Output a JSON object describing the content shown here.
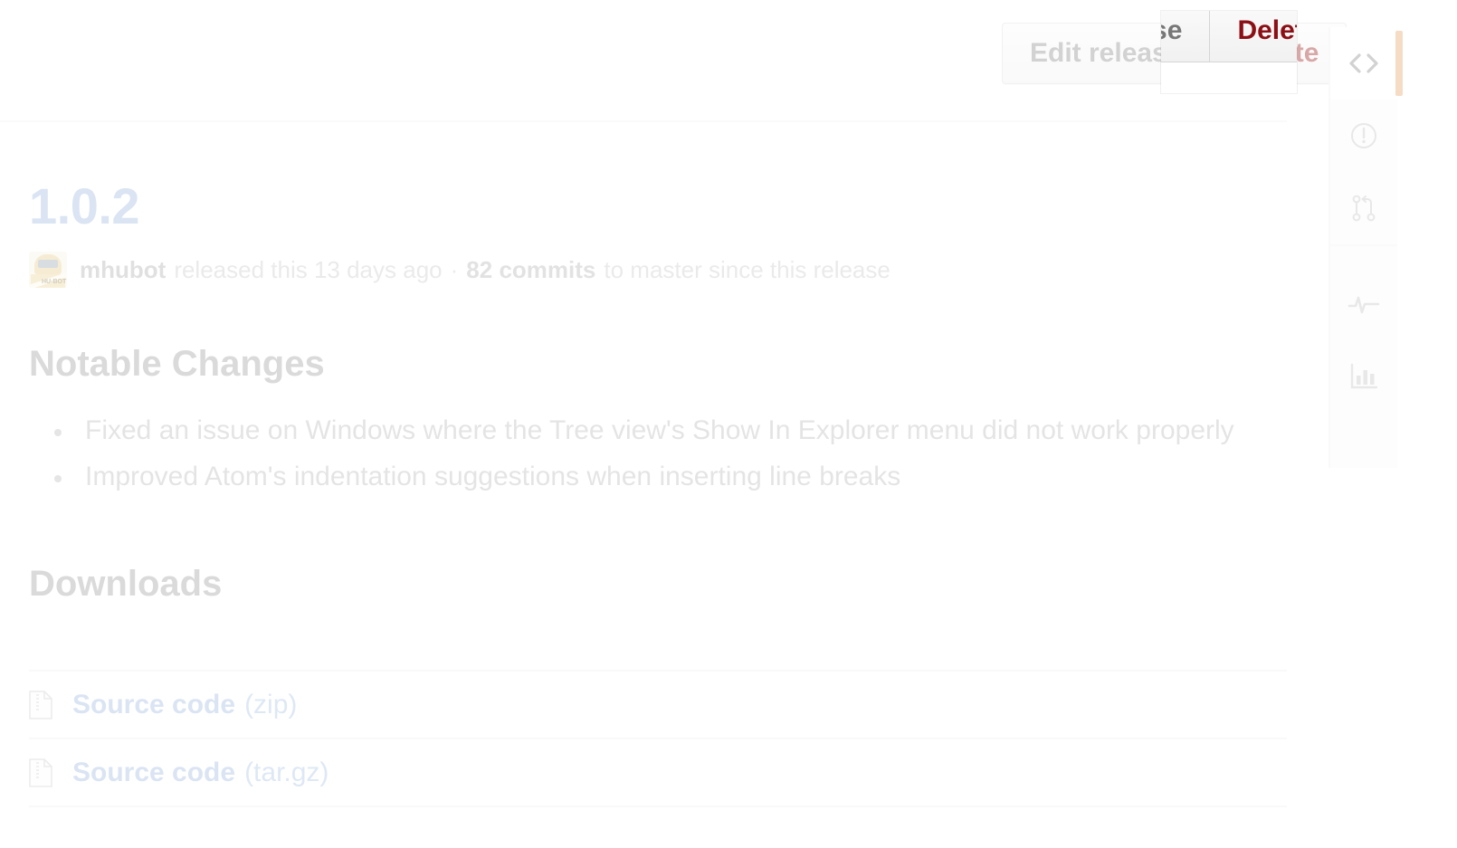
{
  "header": {
    "actions": [
      {
        "label": "Edit release",
        "name": "edit-release-button",
        "variant": "default"
      },
      {
        "label": "Delete",
        "name": "delete-button",
        "variant": "danger"
      }
    ]
  },
  "release": {
    "version": "1.0.2",
    "author": "mhubot",
    "released_text": "released this 13 days ago",
    "separator": "·",
    "commits": "82 commits",
    "commits_suffix": "to master since this release",
    "avatar_label": "HU-BOT",
    "notes_heading": "Notable Changes",
    "notes": [
      "Fixed an issue on Windows where the Tree view's Show In Explorer menu did not work properly",
      "Improved Atom's indentation suggestions when inserting line breaks"
    ]
  },
  "downloads": {
    "heading": "Downloads",
    "items": [
      {
        "name": "Source code",
        "ext": "(zip)",
        "icon": "file-zip-icon"
      },
      {
        "name": "Source code",
        "ext": "(tar.gz)",
        "icon": "file-zip-icon"
      }
    ]
  },
  "sidebar": {
    "items": [
      {
        "icon": "code-icon",
        "name": "rail-item-code",
        "active": true
      },
      {
        "icon": "issue-opened-icon",
        "name": "rail-item-issues",
        "active": false
      },
      {
        "icon": "git-pull-request-icon",
        "name": "rail-item-pull-requests",
        "active": false
      },
      {
        "icon": "pulse-icon",
        "name": "rail-item-pulse",
        "active": false
      },
      {
        "icon": "graph-icon",
        "name": "rail-item-graphs",
        "active": false
      }
    ]
  },
  "focus": {
    "edit_label": "Edit release",
    "delete_label": "Delete"
  },
  "colors": {
    "link": "#9fbbe0",
    "danger": "#9b1c1c",
    "accent": "#e8a46a",
    "text_muted": "#b9b9b9",
    "divider": "#f0f0f0"
  }
}
